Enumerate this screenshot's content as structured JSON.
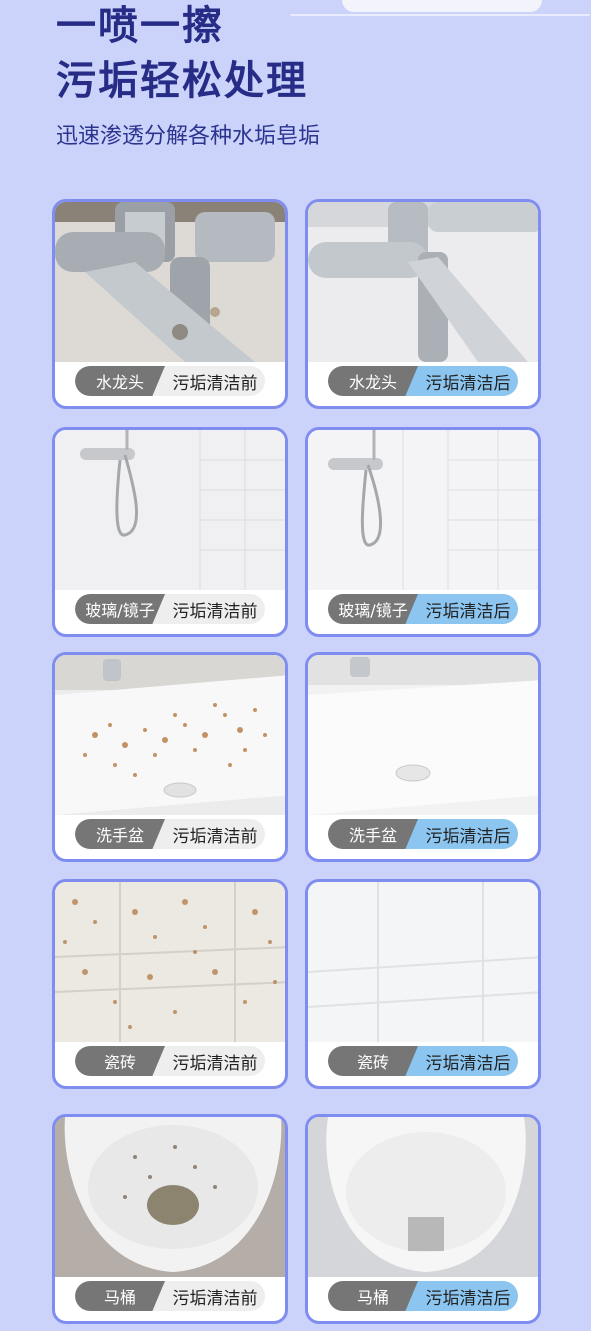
{
  "header": {
    "title_line1": "一喷一擦",
    "title_line2": "污垢轻松处理",
    "subtitle": "迅速渗透分解各种水垢皂垢"
  },
  "colors": {
    "background": "#cbd3fb",
    "title": "#272c86",
    "card_border": "#7f8df0",
    "tag_gray": "#767676",
    "after_blue": "#8cc6f0"
  },
  "rows": [
    {
      "before": {
        "category": "水龙头",
        "status": "污垢清洁前"
      },
      "after": {
        "category": "水龙头",
        "status": "污垢清洁后"
      }
    },
    {
      "before": {
        "category": "玻璃/镜子",
        "status": "污垢清洁前"
      },
      "after": {
        "category": "玻璃/镜子",
        "status": "污垢清洁后"
      }
    },
    {
      "before": {
        "category": "洗手盆",
        "status": "污垢清洁前"
      },
      "after": {
        "category": "洗手盆",
        "status": "污垢清洁后"
      }
    },
    {
      "before": {
        "category": "瓷砖",
        "status": "污垢清洁前"
      },
      "after": {
        "category": "瓷砖",
        "status": "污垢清洁后"
      }
    },
    {
      "before": {
        "category": "马桶",
        "status": "污垢清洁前"
      },
      "after": {
        "category": "马桶",
        "status": "污垢清洁后"
      }
    }
  ]
}
